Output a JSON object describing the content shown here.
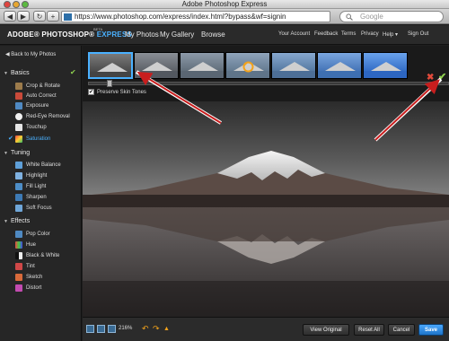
{
  "window": {
    "title": "Adobe Photoshop Express"
  },
  "browser": {
    "back": "◀",
    "forward": "▶",
    "reload": "↻",
    "add": "+",
    "url": "https://www.photoshop.com/express/index.html?bypass&wf=signin",
    "search_placeholder": "Google"
  },
  "header": {
    "brand_prefix": "ADOBE® PHOTOSHOP®",
    "brand_highlight": "EXPRESS",
    "beta": "BETA",
    "nav": [
      "My Photos",
      "My Gallery",
      "Browse"
    ],
    "links": [
      "Your Account",
      "Feedback",
      "Terms",
      "Privacy",
      "Help ▾",
      "Sign Out"
    ]
  },
  "sidebar": {
    "back_label": "◀ Back to My Photos",
    "basics": {
      "title": "Basics",
      "items": [
        {
          "label": "Crop & Rotate",
          "icon": "crop-icon"
        },
        {
          "label": "Auto Correct",
          "icon": "auto-correct-icon"
        },
        {
          "label": "Exposure",
          "icon": "exposure-icon"
        },
        {
          "label": "Red-Eye Removal",
          "icon": "red-eye-icon"
        },
        {
          "label": "Touchup",
          "icon": "touchup-icon"
        },
        {
          "label": "Saturation",
          "icon": "saturation-icon"
        }
      ]
    },
    "tuning": {
      "title": "Tuning",
      "items": [
        {
          "label": "White Balance",
          "icon": "white-balance-icon"
        },
        {
          "label": "Highlight",
          "icon": "highlight-icon"
        },
        {
          "label": "Fill Light",
          "icon": "fill-light-icon"
        },
        {
          "label": "Sharpen",
          "icon": "sharpen-icon"
        },
        {
          "label": "Soft Focus",
          "icon": "soft-focus-icon"
        }
      ]
    },
    "effects": {
      "title": "Effects",
      "items": [
        {
          "label": "Pop Color",
          "icon": "pop-color-icon"
        },
        {
          "label": "Hue",
          "icon": "hue-icon"
        },
        {
          "label": "Black & White",
          "icon": "black-white-icon"
        },
        {
          "label": "Tint",
          "icon": "tint-icon"
        },
        {
          "label": "Sketch",
          "icon": "sketch-icon"
        },
        {
          "label": "Distort",
          "icon": "distort-icon"
        }
      ]
    },
    "done_check": "✔",
    "active_check": "✔"
  },
  "editor": {
    "preserve_skin_tones": "Preserve Skin Tones",
    "preserve_checked": true,
    "slider_level": 0.05,
    "cancel": "✖",
    "apply": "✔"
  },
  "bottom": {
    "zoom": "216%",
    "undo": "↶",
    "redo": "↷",
    "view_original": "View Original",
    "reset_all": "Reset All",
    "cancel": "Cancel",
    "save": "Save"
  },
  "colors": {
    "accent": "#4ab1ff",
    "apply": "#8fd14f",
    "cancel": "#e24a3b",
    "arrow": "#c81e1e"
  }
}
